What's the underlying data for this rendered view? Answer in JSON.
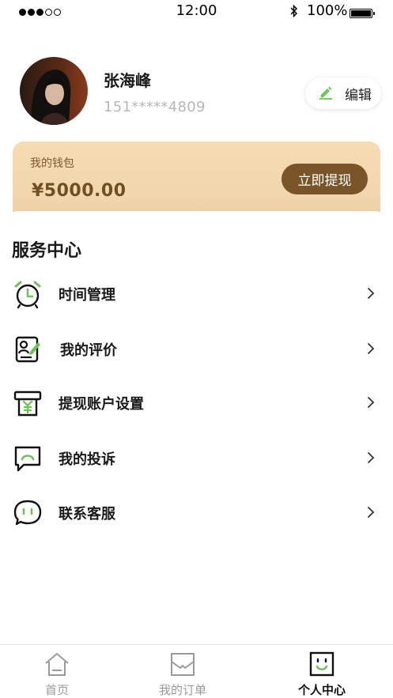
{
  "status_bar": {
    "time": "12:00",
    "battery": "100%"
  },
  "profile": {
    "name": "张海峰",
    "phone": "151*****4809",
    "edit_label": "编辑"
  },
  "wallet": {
    "title": "我的钱包",
    "amount": "¥5000.00",
    "withdraw_label": "立即提现"
  },
  "service_center": {
    "title": "服务中心",
    "items": [
      {
        "label": "时间管理",
        "icon": "alarm-clock-icon"
      },
      {
        "label": "我的评价",
        "icon": "review-icon"
      },
      {
        "label": "提现账户设置",
        "icon": "withdraw-account-icon"
      },
      {
        "label": "我的投诉",
        "icon": "complaint-icon"
      },
      {
        "label": "联系客服",
        "icon": "customer-service-icon"
      }
    ]
  },
  "tabs": [
    {
      "label": "首页",
      "icon": "home-icon",
      "active": false
    },
    {
      "label": "我的订单",
      "icon": "orders-icon",
      "active": false
    },
    {
      "label": "个人中心",
      "icon": "profile-icon",
      "active": true
    }
  ],
  "colors": {
    "accent_green": "#6fc15a",
    "wallet_brown": "#7a5429",
    "wallet_gradient": "#f2d6ae"
  }
}
